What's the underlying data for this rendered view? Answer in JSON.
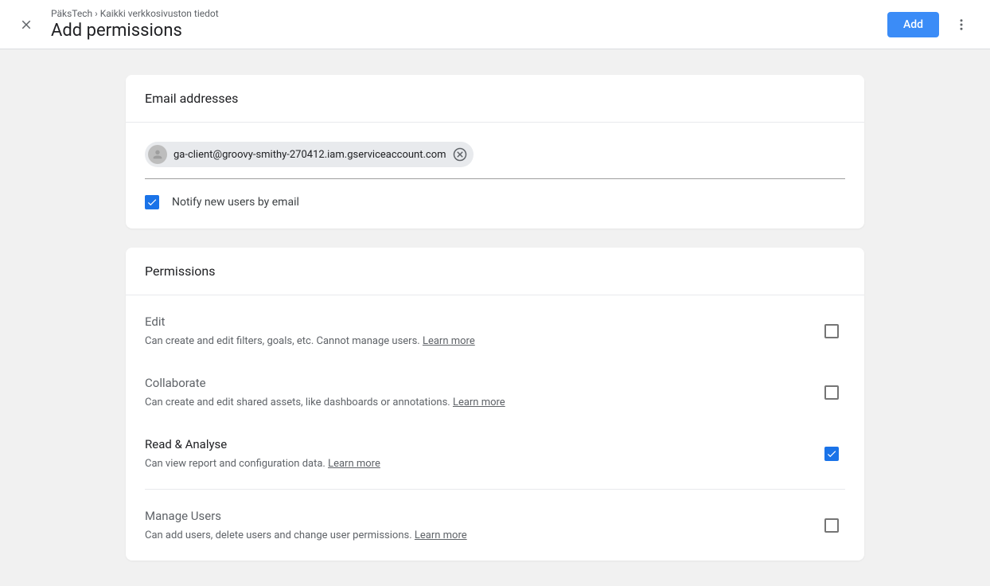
{
  "header": {
    "breadcrumb": "PäksTech › Kaikki verkkosivuston tiedot",
    "title": "Add permissions",
    "add_button": "Add"
  },
  "email_section": {
    "header": "Email addresses",
    "chip_email": "ga-client@groovy-smithy-270412.iam.gserviceaccount.com",
    "notify_label": "Notify new users by email",
    "notify_checked": true
  },
  "permissions_section": {
    "header": "Permissions",
    "items": [
      {
        "title": "Edit",
        "desc": "Can create and edit filters, goals, etc. Cannot manage users. ",
        "learn": "Learn more",
        "checked": false,
        "selected": false
      },
      {
        "title": "Collaborate",
        "desc": "Can create and edit shared assets, like dashboards or annotations. ",
        "learn": "Learn more",
        "checked": false,
        "selected": false
      },
      {
        "title": "Read & Analyse",
        "desc": "Can view report and configuration data. ",
        "learn": "Learn more",
        "checked": true,
        "selected": true
      }
    ],
    "manage": {
      "title": "Manage Users",
      "desc": "Can add users, delete users and change user permissions. ",
      "learn": "Learn more",
      "checked": false
    }
  }
}
